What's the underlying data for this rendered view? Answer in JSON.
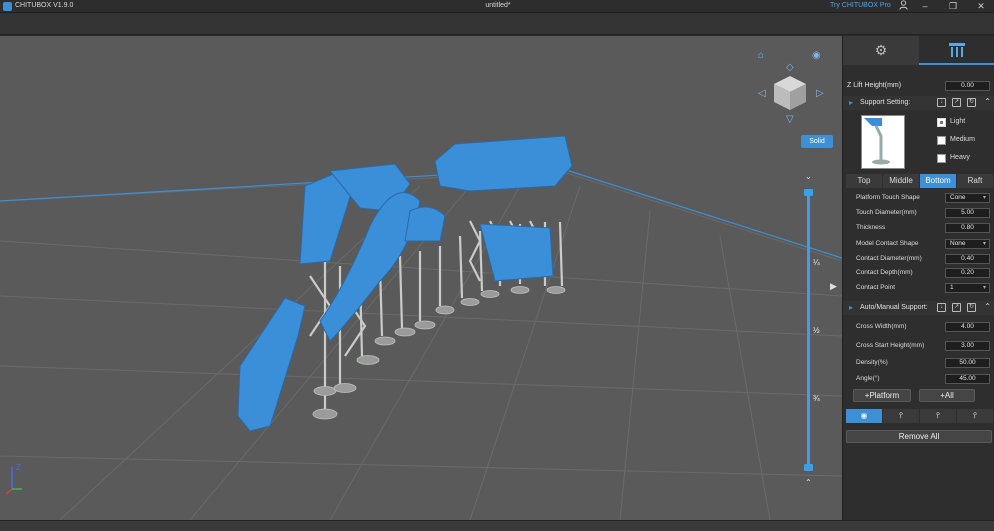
{
  "titlebar": {
    "app_name": "CHITUBOX V1.9.0",
    "document": "untitled*",
    "try_pro": "Try CHITUBOX Pro",
    "icons": [
      "user-icon",
      "minimize-icon",
      "restore-icon",
      "close-icon"
    ]
  },
  "viewport": {
    "solid_button": "Solid",
    "slider_labels": [
      "¼",
      "½",
      "¾"
    ],
    "accent": "#3d8fd6",
    "model_color": "#3a8fd8"
  },
  "panel": {
    "tabs": [
      "settings-icon",
      "support-icon"
    ],
    "z_lift": {
      "label": "Z Lift Height(mm)",
      "value": "0.00"
    },
    "support_setting": {
      "title": "Support Setting:"
    },
    "weights": [
      {
        "label": "Light",
        "checked": true
      },
      {
        "label": "Medium",
        "checked": false
      },
      {
        "label": "Heavy",
        "checked": false
      }
    ],
    "segments": [
      "Top",
      "Middle",
      "Bottom",
      "Raft"
    ],
    "active_segment": "Bottom",
    "fields": {
      "platform_touch_shape": {
        "label": "Platform Touch Shape",
        "value": "Cone"
      },
      "touch_diameter": {
        "label": "Touch Diameter(mm)",
        "value": "5.00"
      },
      "thickness": {
        "label": "Thickness",
        "value": "0.80"
      },
      "model_contact_shape": {
        "label": "Model Contact Shape",
        "value": "None"
      },
      "contact_diameter": {
        "label": "Contact Diameter(mm)",
        "value": "0.40"
      },
      "contact_depth": {
        "label": "Contact Depth(mm)",
        "value": "0.20"
      },
      "contact_point": {
        "label": "Contact Point",
        "value": "1"
      }
    },
    "auto_manual": {
      "title": "Auto/Manual Support:"
    },
    "auto_fields": {
      "cross_width": {
        "label": "Cross Width(mm)",
        "value": "4.00"
      },
      "cross_start_height": {
        "label": "Cross Start Height(mm)",
        "value": "3.00"
      },
      "density": {
        "label": "Density(%)",
        "value": "50.00"
      },
      "angle": {
        "label": "Angle(°)",
        "value": "45.00"
      }
    },
    "buttons": {
      "platform": "+Platform",
      "all": "+All",
      "remove_all": "Remove All"
    }
  }
}
